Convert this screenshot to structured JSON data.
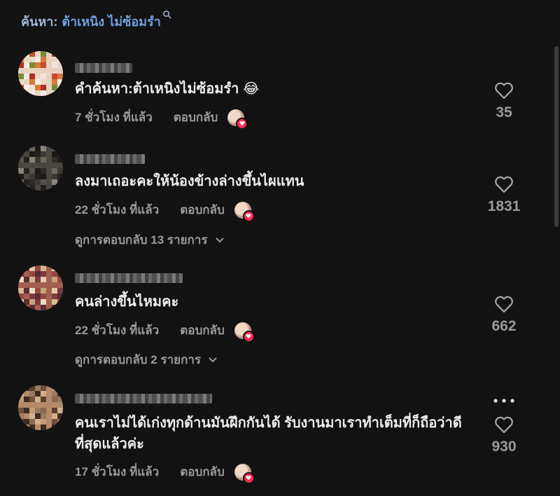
{
  "search": {
    "prefix": "ค้นหา:",
    "query": "ต้าเหนิง ไม่ซ้อมรำ"
  },
  "comments": [
    {
      "text": "คำค้นหา:ต้าเหนิงไม่ซ้อมรำ 😂",
      "time": "7 ชั่วโมง ที่แล้ว",
      "reply_label": "ตอบกลับ",
      "likes": "35"
    },
    {
      "text": "ลงมาเถอะคะให้น้องข้างล่างขึ้นไผแทน",
      "time": "22 ชั่วโมง ที่แล้ว",
      "reply_label": "ตอบกลับ",
      "likes": "1831",
      "view_replies": "ดูการตอบกลับ 13 รายการ"
    },
    {
      "text": "คนล่างขึ้นไหมคะ",
      "time": "22 ชั่วโมง ที่แล้ว",
      "reply_label": "ตอบกลับ",
      "likes": "662",
      "view_replies": "ดูการตอบกลับ 2 รายการ"
    },
    {
      "text": "คนเราไม่ได้เก่งทุกด้านมันฝึกกันได้ รับงานมาเราทำเต็มที่ก็ถือว่าดีที่สุดแล้วค่ะ",
      "time": "17 ชั่วโมง ที่แล้ว",
      "reply_label": "ตอบกลับ",
      "likes": "930"
    }
  ],
  "icons": {
    "search": "search-icon",
    "like": "heart-outline-icon",
    "more": "more-horizontal-icon",
    "expand": "chevron-down-icon",
    "creator_liked": "creator-liked-badge"
  },
  "colors": {
    "background": "#121212",
    "search_link": "#6f9fe0",
    "muted_text": "#9a9a9a",
    "badge": "#fe2c55"
  }
}
